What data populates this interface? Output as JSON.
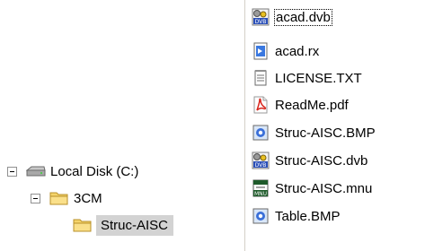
{
  "files": [
    {
      "name": "acad.dvb",
      "icon": "vba-project-icon",
      "focused": true
    },
    {
      "name": "acad.rx",
      "icon": "blue-document-icon"
    },
    {
      "name": "LICENSE.TXT",
      "icon": "text-file-icon"
    },
    {
      "name": "ReadMe.pdf",
      "icon": "pdf-icon"
    },
    {
      "name": "Struc-AISC.BMP",
      "icon": "bitmap-image-icon"
    },
    {
      "name": "Struc-AISC.dvb",
      "icon": "vba-project-icon"
    },
    {
      "name": "Struc-AISC.mnu",
      "icon": "menu-file-icon"
    },
    {
      "name": "Table.BMP",
      "icon": "bitmap-image-icon"
    }
  ],
  "tree": {
    "drive": {
      "label": "Local Disk (C:)",
      "icon": "hard-disk-icon"
    },
    "folder": {
      "label": "3CM",
      "icon": "folder-icon"
    },
    "subfolder": {
      "label": "Struc-AISC",
      "icon": "folder-icon",
      "selected": true
    }
  },
  "colors": {
    "selection": "#d3d3d3",
    "folder": "#f5d46b",
    "pdf_red": "#d8261d",
    "bmp_blue": "#3a6fd8"
  }
}
